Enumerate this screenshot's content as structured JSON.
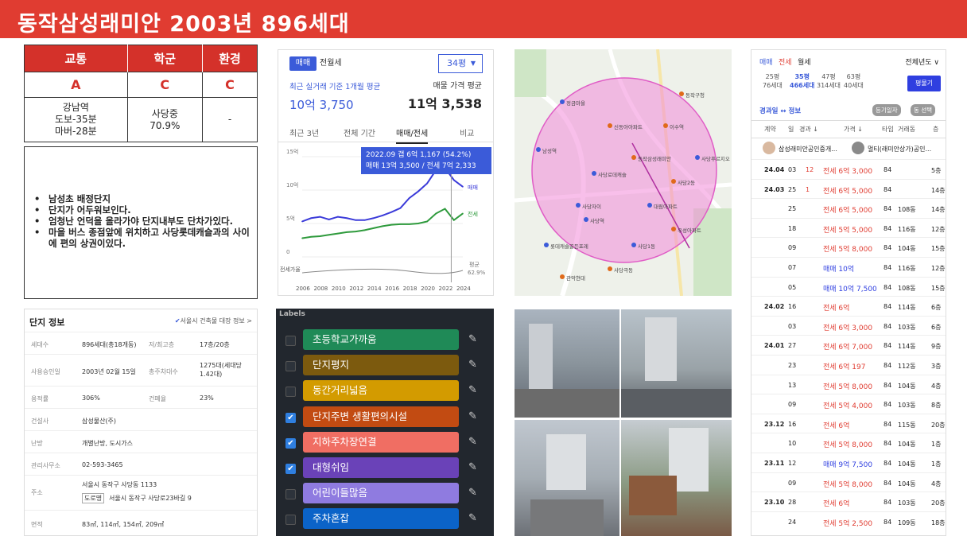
{
  "header": {
    "title": "동작삼성래미안  2003년 896세대"
  },
  "score": {
    "heads": [
      "교통",
      "학군",
      "환경"
    ],
    "grades": [
      "A",
      "C",
      "C"
    ],
    "details": [
      [
        "강남역",
        "도보-35분",
        "마버-28분"
      ],
      [
        "사당중",
        "70.9%"
      ],
      [
        "-"
      ]
    ]
  },
  "notes": [
    "남성초 배정단지",
    "단지가 어두워보인다.",
    "엄청난 언덕을 올라가야 단지내부도 단차가있다.",
    "마을 버스 종점앞에 위치하고 사당롯데캐슬과의 사이에 편의 상권이있다."
  ],
  "info": {
    "title": "단지 정보",
    "link": "서울시 건축물 대장 정보 >",
    "rows": [
      {
        "k": "세대수",
        "v": "896세대(총18개동)",
        "k2": "저/최고층",
        "v2": "17층/20층"
      },
      {
        "k": "사용승인일",
        "v": "2003년 02월 15일",
        "k2": "총주차대수",
        "v2": "1275대(세대당 1.42대)"
      },
      {
        "k": "용적률",
        "v": "306%",
        "k2": "건폐율",
        "v2": "23%"
      },
      {
        "k": "건설사",
        "v": "삼성물산(주)",
        "k2": "",
        "v2": ""
      },
      {
        "k": "난방",
        "v": "개별난방, 도시가스",
        "k2": "",
        "v2": ""
      },
      {
        "k": "관리사무소",
        "v": "02-593-3465",
        "k2": "",
        "v2": ""
      },
      {
        "k": "주소",
        "v": "서울시 동작구 사당동 1133",
        "k2": "",
        "v2": ""
      },
      {
        "k": "면적",
        "v": "83㎡, 114㎡, 154㎡, 209㎡",
        "k2": "",
        "v2": ""
      }
    ],
    "road_tag": "도로명",
    "road_addr": "서울시 동작구 사당로23바길 9"
  },
  "price": {
    "tab_sale": "매매",
    "tab_rent": "전월세",
    "size": "34평",
    "recent_label": "최근 실거래 기준 1개월 평균",
    "recent_value": "10억 3,750",
    "ask_label": "매물 가격 평균",
    "ask_value": "11억 3,538",
    "tabs": [
      "최근 3년",
      "전체 기간",
      "매매/전세",
      "비교"
    ],
    "tip1": "2022.09  갭 6억 1,167 (54.2%)",
    "tip2": "매매 13억 3,500 / 전세 7억 2,333",
    "yticks": [
      "15억",
      "10억",
      "5억",
      "0"
    ],
    "xticks": [
      "2006",
      "2008",
      "2010",
      "2012",
      "2014",
      "2016",
      "2018",
      "2020",
      "2022",
      "2024"
    ],
    "leg_sale": "매매",
    "leg_rent": "전세",
    "gap_label": "전세가율",
    "avg_label": "평균",
    "avg_value": "62.9%",
    "colors": {
      "sale": "#3b3bd9",
      "rent": "#2e9a3c"
    }
  },
  "chart_data": {
    "type": "line",
    "x": [
      2006,
      2007,
      2008,
      2009,
      2010,
      2011,
      2012,
      2013,
      2014,
      2015,
      2016,
      2017,
      2018,
      2019,
      2020,
      2021,
      2022,
      2023,
      2024
    ],
    "series": [
      {
        "name": "매매",
        "values": [
          5.3,
          5.8,
          6.0,
          5.6,
          6.0,
          5.8,
          5.5,
          5.5,
          5.8,
          6.2,
          6.7,
          7.3,
          8.8,
          9.8,
          11.0,
          13.0,
          13.3,
          11.5,
          10.5
        ]
      },
      {
        "name": "전세",
        "values": [
          2.8,
          3.0,
          3.1,
          3.3,
          3.5,
          3.7,
          3.8,
          4.0,
          4.3,
          4.6,
          4.8,
          4.9,
          4.9,
          5.0,
          5.3,
          6.5,
          7.2,
          5.5,
          6.5
        ]
      }
    ],
    "ylim": [
      0,
      15
    ]
  },
  "labels": {
    "title": "Labels",
    "items": [
      {
        "text": "초등학교가까움",
        "color": "#1f8a57",
        "checked": false
      },
      {
        "text": "단지평지",
        "color": "#7c5a0e",
        "checked": false
      },
      {
        "text": "동간거리넓음",
        "color": "#d39b00",
        "checked": false
      },
      {
        "text": "단지주변 생활편의시설",
        "color": "#c24b12",
        "checked": true
      },
      {
        "text": "지하주차장연결",
        "color": "#f06e63",
        "checked": true
      },
      {
        "text": "대형쉬임",
        "color": "#6a42b8",
        "checked": true
      },
      {
        "text": "어린이들많음",
        "color": "#8f7be0",
        "checked": false
      },
      {
        "text": "주차혼잡",
        "color": "#0b63c8",
        "checked": false
      }
    ]
  },
  "map": {
    "labels": [
      "사당역",
      "이수역",
      "사당1동",
      "사당2동",
      "남성역",
      "동작구청",
      "정금마을",
      "신동아아파트",
      "사당로데캐슬",
      "우성아파트",
      "롯데캐슬골든포레",
      "동작삼성래미안",
      "사당자이",
      "사당극동",
      "대림아파트",
      "관악현대",
      "사당푸르지오"
    ]
  },
  "tx": {
    "tab_sale": "매매",
    "tab_rent": "전세",
    "tab_month": "월세",
    "year": "전체년도 ∨",
    "sizes": [
      {
        "p": "25평",
        "h": "76세대"
      },
      {
        "p": "35평",
        "h": "466세대"
      },
      {
        "p": "47평",
        "h": "314세대"
      },
      {
        "p": "63평",
        "h": "40세대"
      }
    ],
    "btn": "평물기",
    "sort": "경과일 ↔ 정보",
    "b1": "등기일자",
    "b2": "동 선택",
    "cols": [
      "계약",
      "일",
      "경과 ↓",
      "가격 ↓",
      "타입",
      "거래동",
      "층"
    ],
    "agents": [
      "삼성래미안공인중개...",
      "멀티(래미안상가)공인..."
    ],
    "rows": [
      [
        "24.04",
        "03",
        "12",
        "전세 6억 3,000",
        "84",
        "",
        "5층"
      ],
      [
        "24.03",
        "25",
        "1",
        "전세 6억 5,000",
        "84",
        "",
        "14층"
      ],
      [
        "",
        "25",
        "",
        "전세 6억 5,000",
        "84",
        "108동",
        "14층"
      ],
      [
        "",
        "18",
        "",
        "전세 5억 5,000",
        "84",
        "116동",
        "12층"
      ],
      [
        "",
        "09",
        "",
        "전세 5억 8,000",
        "84",
        "104동",
        "15층"
      ],
      [
        "",
        "07",
        "",
        "매매 10억",
        "84",
        "116동",
        "12층"
      ],
      [
        "",
        "05",
        "",
        "매매 10억 7,500",
        "84",
        "108동",
        "15층"
      ],
      [
        "24.02",
        "16",
        "",
        "전세 6억",
        "84",
        "114동",
        "6층"
      ],
      [
        "",
        "03",
        "",
        "전세 6억 3,000",
        "84",
        "103동",
        "6층"
      ],
      [
        "24.01",
        "27",
        "",
        "전세 6억 7,000",
        "84",
        "114동",
        "9층"
      ],
      [
        "",
        "23",
        "",
        "전세 6억 197",
        "84",
        "112동",
        "3층"
      ],
      [
        "",
        "13",
        "",
        "전세 5억 8,000",
        "84",
        "104동",
        "4층"
      ],
      [
        "",
        "09",
        "",
        "전세 5억 4,000",
        "84",
        "103동",
        "8층"
      ],
      [
        "23.12",
        "16",
        "",
        "전세 6억",
        "84",
        "115동",
        "20층"
      ],
      [
        "",
        "10",
        "",
        "전세 5억 8,000",
        "84",
        "104동",
        "1층"
      ],
      [
        "23.11",
        "12",
        "",
        "매매 9억 7,500",
        "84",
        "104동",
        "1층"
      ],
      [
        "",
        "09",
        "",
        "전세 5억 8,000",
        "84",
        "104동",
        "4층"
      ],
      [
        "23.10",
        "28",
        "",
        "전세 6억",
        "84",
        "103동",
        "20층"
      ],
      [
        "",
        "24",
        "",
        "전세 5억 2,500",
        "84",
        "109동",
        "18층"
      ]
    ]
  }
}
